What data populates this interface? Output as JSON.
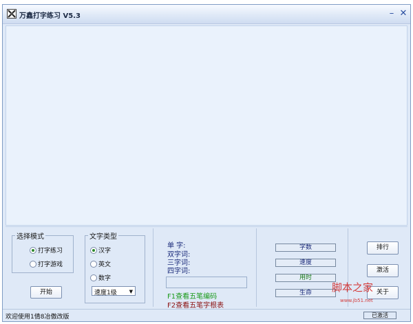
{
  "window": {
    "title": "万鑫打字练习 V5.3",
    "minimize": "–",
    "close": "✕"
  },
  "mode_group": {
    "legend": "选择模式",
    "options": [
      {
        "label": "打字练习",
        "selected": true
      },
      {
        "label": "打字游戏",
        "selected": false
      }
    ],
    "start_button": "开始"
  },
  "text_type_group": {
    "legend": "文字类型",
    "options": [
      {
        "label": "汉字",
        "selected": true
      },
      {
        "label": "英文",
        "selected": false
      },
      {
        "label": "数字",
        "selected": false
      }
    ],
    "speed_select": "速度1级"
  },
  "stats": {
    "single": "单  字:",
    "double": "双字词:",
    "triple": "三字词:",
    "quad": "四字词:"
  },
  "hints": {
    "f1": "F1查看五笔编码",
    "f2": "F2查看五笔字根表"
  },
  "metrics": {
    "chars": "字数",
    "speed": "速度",
    "time": "用时",
    "life": "生命"
  },
  "actions": {
    "rank": "排行",
    "activate": "激活",
    "about": "关于"
  },
  "statusbar": {
    "welcome": "欢迎使用1倩8冶傲改版",
    "badge": "已激活"
  },
  "watermark": {
    "main": "脚本之家",
    "url": "www.jb51.net"
  },
  "colors": {
    "green_hint": "#1a9a1a",
    "red_hint": "#8a1010",
    "metric_green": "#1a7a1a",
    "metric_blue": "#1a2a7a",
    "metric_red": "#b01a1a"
  }
}
